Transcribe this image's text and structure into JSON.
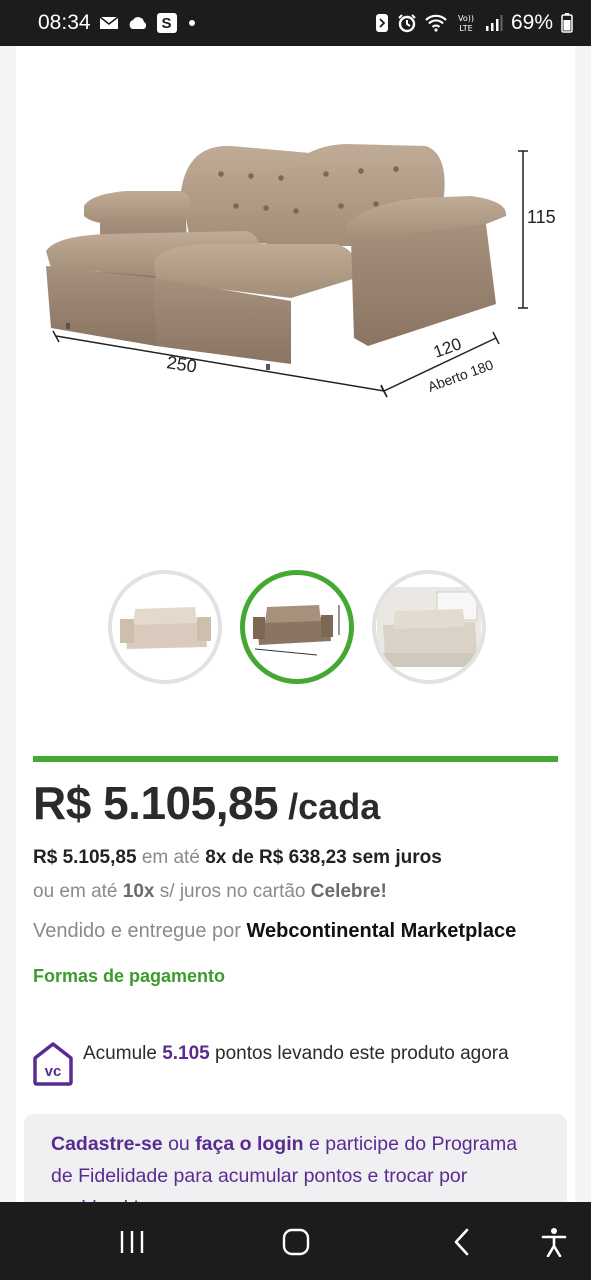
{
  "status_bar": {
    "time": "08:34",
    "battery": "69%",
    "s_badge": "S",
    "icons": [
      "mail-icon",
      "cloud-icon",
      "s-app-icon",
      "dot-icon",
      "nfc-icon",
      "alarm-icon",
      "wifi-icon",
      "volte-icon",
      "signal-icon",
      "battery-icon"
    ]
  },
  "product_image": {
    "dim_height": "115",
    "dim_width": "250",
    "dim_depth": "120",
    "dim_open": "Aberto 180"
  },
  "thumbnails": [
    {
      "name": "sofa-front-view",
      "active": false
    },
    {
      "name": "sofa-dimensions-view",
      "active": true
    },
    {
      "name": "sofa-room-view",
      "active": false
    }
  ],
  "colors": {
    "accent_green": "#44a832",
    "brand_purple": "#5a2c91"
  },
  "pricing": {
    "price": "R$ 5.105,85",
    "unit": "/cada",
    "install_total": "R$ 5.105,85",
    "install_em_ate": "em até",
    "install_detail": "8x de R$ 638,23 sem juros",
    "card_prefix": "ou em até",
    "card_count": "10x",
    "card_middle": "s/ juros no cartão",
    "card_name": "Celebre!",
    "seller_prefix": "Vendido e entregue por",
    "seller_name": "Webcontinental Marketplace",
    "payment_link": "Formas de pagamento"
  },
  "loyalty": {
    "prefix": "Acumule",
    "points": "5.105",
    "suffix": "pontos levando este produto agora"
  },
  "signup": {
    "link_register": "Cadastre-se",
    "or": "ou",
    "link_login": "faça o login",
    "text": "e participe do Programa de Fidelidade para acumular pontos e",
    "cut_text": "trocar por cashback!"
  },
  "nav": [
    "recent-apps-icon",
    "home-icon",
    "back-icon",
    "accessibility-icon"
  ]
}
